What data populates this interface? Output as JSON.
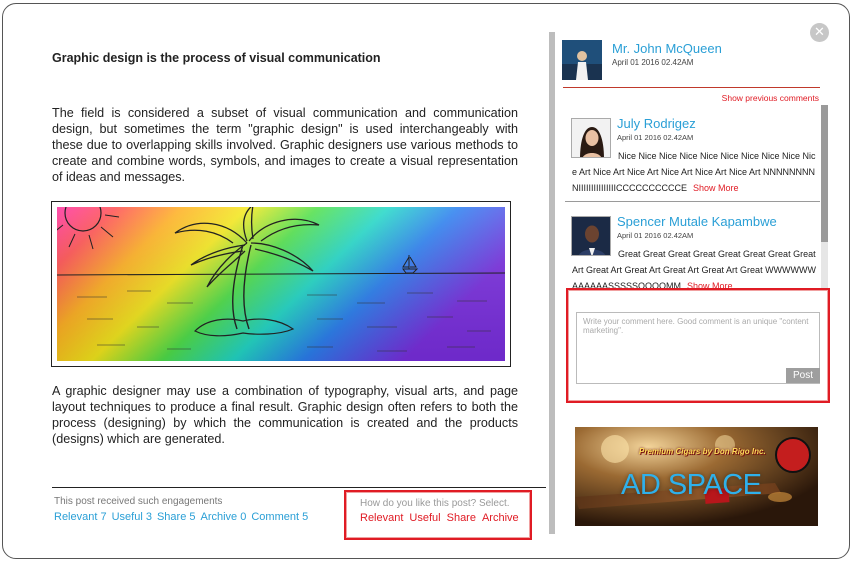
{
  "post": {
    "title": "Graphic design is the process of visual communication",
    "paragraph1": "The field is considered a subset of visual communication and communication design, but sometimes the term \"graphic design\" is used interchangeably with these due to overlapping skills involved. Graphic designers use various methods to create and combine words, symbols, and images to create a visual representation of ideas and messages.",
    "paragraph2": "A graphic designer may use a combination of typography, visual arts, and page layout techniques to produce a final result. Graphic design often refers to both the process (designing) by which the communication is created and the products (designs) which are generated."
  },
  "engagement": {
    "caption": "This post received such engagements",
    "relevant": "Relevant 7",
    "useful": "Useful 3",
    "share": "Share 5",
    "archive": "Archive 0",
    "comment": "Comment 5"
  },
  "reaction": {
    "question": "How do you like this post? Select.",
    "relevant": "Relevant",
    "useful": "Useful",
    "share": "Share",
    "archive": "Archive"
  },
  "author": {
    "name": "Mr. John McQueen",
    "date": "April 01 2016 02.42AM"
  },
  "comments": {
    "show_previous": "Show previous comments",
    "items": [
      {
        "name": "July Rodrigez",
        "date": "April 01 2016 02.42AM",
        "text": "Nice Nice Nice Nice Nice Nice Nice Nice Nice Nice Art Nice Art Nice Art Nice Art Nice Art Nice Art NNNNNNNNNIIIIIIIIIIIIIIICCCCCCCCCCE",
        "more": "Show More"
      },
      {
        "name": "Spencer Mutale Kapambwe",
        "date": "April 01 2016 02.42AM",
        "text": "Great Great Great Great Great Great Great Great Art Great Art Great Art Great Art Great Art Great WWWWWWAAAAAASSSSSOOOOMM",
        "more": "Show More"
      }
    ]
  },
  "comment_form": {
    "placeholder": "Write your comment here. Good comment is an unique \"content marketing\".",
    "post_label": "Post"
  },
  "ad": {
    "tagline": "Premium Cigars by Don Rigo Inc.",
    "label": "AD SPACE"
  },
  "colors": {
    "link_blue": "#2a9fd6",
    "accent_red": "#e01b24",
    "divider_gray": "#bdbdbd"
  },
  "icons": {
    "close": "close-icon"
  }
}
